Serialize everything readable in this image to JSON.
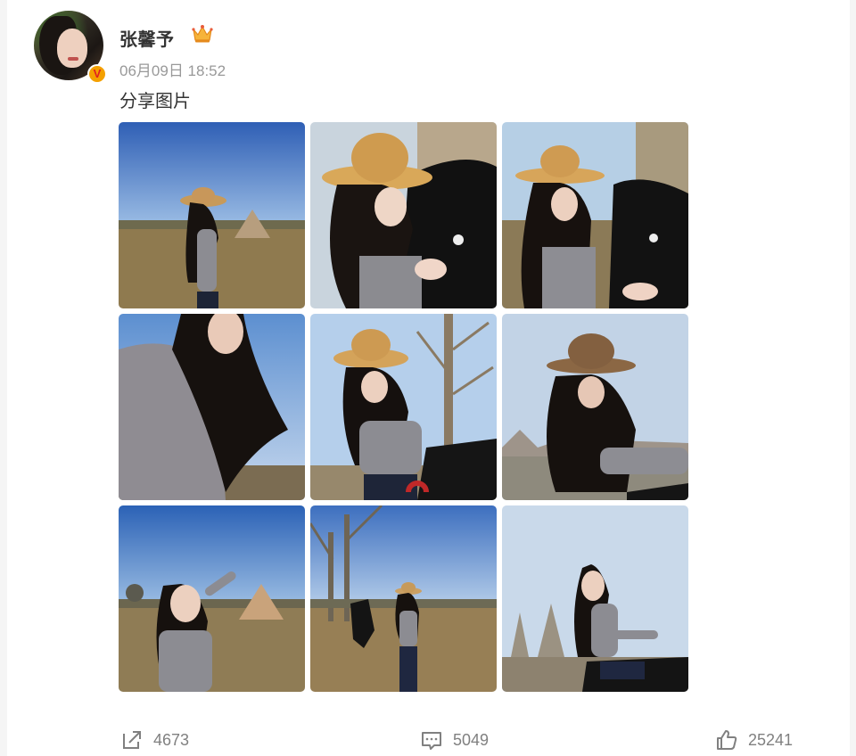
{
  "post": {
    "username": "张馨予",
    "time": "06月09日 18:52",
    "text": "分享图片",
    "badge": "V"
  },
  "images": [
    {
      "name": "photo-1",
      "alt": "woman in cowboy hat in field"
    },
    {
      "name": "photo-2",
      "alt": "woman in straw hat with black horse"
    },
    {
      "name": "photo-3",
      "alt": "woman in straw hat holding horse"
    },
    {
      "name": "photo-4",
      "alt": "woman with long hair against sky"
    },
    {
      "name": "photo-5",
      "alt": "woman in straw hat by tree"
    },
    {
      "name": "photo-6",
      "alt": "woman in brown cowboy hat"
    },
    {
      "name": "photo-7",
      "alt": "woman posing in field with tent"
    },
    {
      "name": "photo-8",
      "alt": "woman walking with horse behind"
    },
    {
      "name": "photo-9",
      "alt": "woman riding horse"
    }
  ],
  "actions": {
    "share_count": "4673",
    "comment_count": "5049",
    "like_count": "25241"
  },
  "colors": {
    "accent_badge": "#f4a000",
    "text_primary": "#333333",
    "text_muted": "#999999",
    "action_gray": "#808080"
  }
}
